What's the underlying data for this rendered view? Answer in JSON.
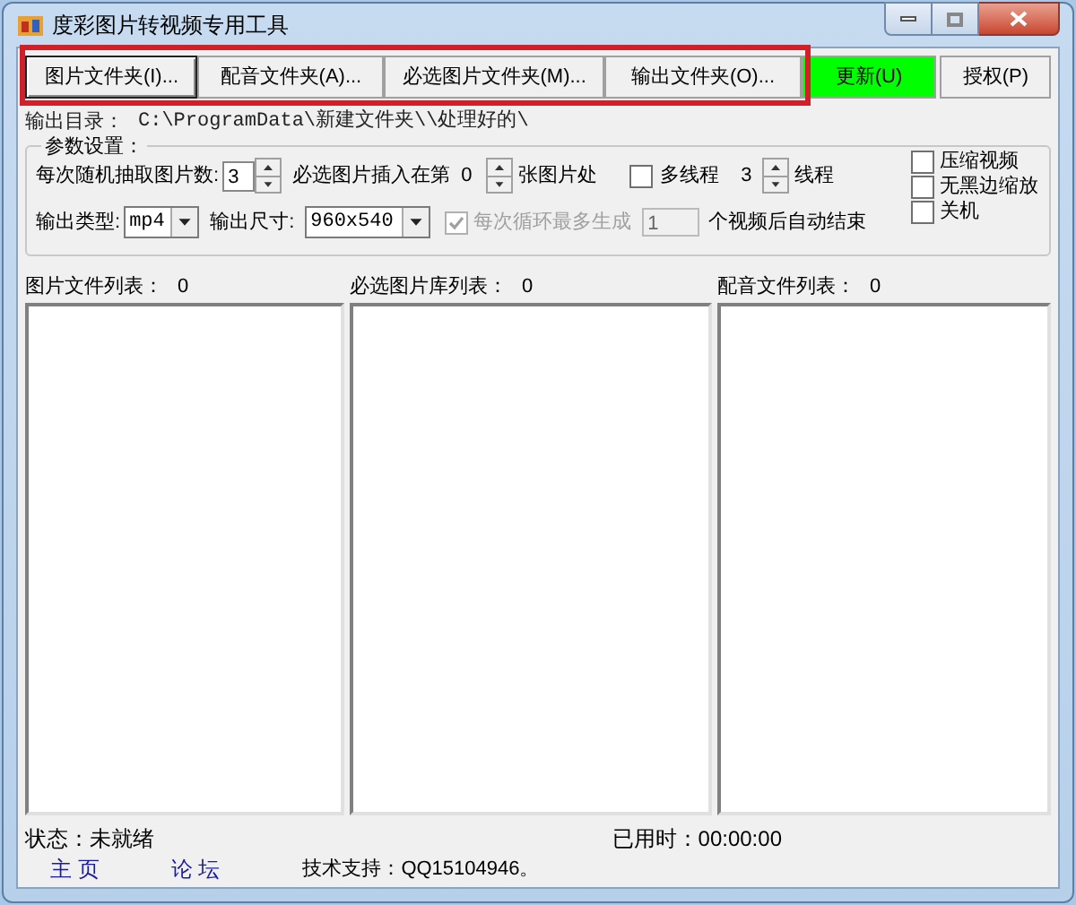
{
  "window": {
    "title": "度彩图片转视频专用工具"
  },
  "toolbar": [
    {
      "label": "图片文件夹(I)...",
      "selected": true,
      "color": "#f0f0f0"
    },
    {
      "label": "配音文件夹(A)...",
      "selected": false,
      "color": "#f0f0f0"
    },
    {
      "label": "必选图片文件夹(M)...",
      "selected": false,
      "color": "#f0f0f0"
    },
    {
      "label": "输出文件夹(O)...",
      "selected": false,
      "color": "#f0f0f0"
    },
    {
      "label": "更新(U)",
      "selected": false,
      "color": "#00ff00"
    },
    {
      "label": "授权(P)",
      "selected": false,
      "color": "#f0f0f0"
    }
  ],
  "output_dir": {
    "label": "输出目录：",
    "value": "C:\\ProgramData\\新建文件夹\\\\处理好的\\"
  },
  "params": {
    "title": "参数设置：",
    "random_count": {
      "label": "每次随机抽取图片数:",
      "value": "3"
    },
    "insert_at": {
      "label": "必选图片插入在第",
      "value": "0",
      "suffix": "张图片处"
    },
    "multithread": {
      "label": "多线程",
      "checked": false,
      "value": "3",
      "suffix": "线程"
    },
    "output_type": {
      "label": "输出类型:",
      "value": "mp4"
    },
    "output_size": {
      "label": "输出尺寸:",
      "value": "960x540"
    },
    "loop_limit": {
      "label": "每次循环最多生成",
      "checked": true,
      "disabled": true,
      "value": "1",
      "suffix": "个视频后自动结束"
    },
    "options": [
      {
        "label": "压缩视频",
        "checked": false
      },
      {
        "label": "无黑边缩放",
        "checked": false
      },
      {
        "label": "关机",
        "checked": false
      }
    ]
  },
  "lists": [
    {
      "label": "图片文件列表：",
      "count": "0"
    },
    {
      "label": "必选图片库列表：",
      "count": "0"
    },
    {
      "label": "配音文件列表：",
      "count": "0"
    }
  ],
  "status": {
    "text": "状态：未就绪",
    "elapsed": "已用时：00:00:00"
  },
  "footer": {
    "links": [
      "主 页",
      "论 坛"
    ],
    "support": "技术支持：QQ15104946。"
  }
}
